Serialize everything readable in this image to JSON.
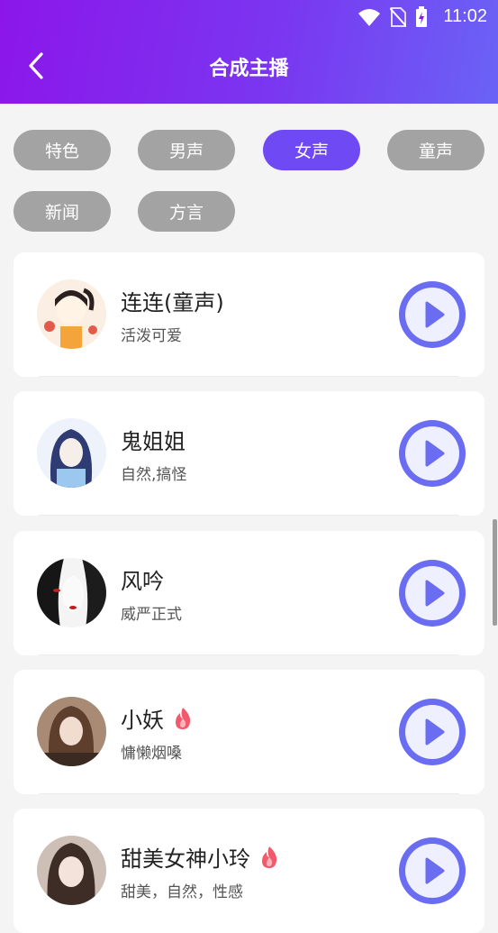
{
  "status_bar": {
    "time": "11:02"
  },
  "header": {
    "title": "合成主播"
  },
  "categories": [
    {
      "label": "特色",
      "active": false
    },
    {
      "label": "男声",
      "active": false
    },
    {
      "label": "女声",
      "active": true
    },
    {
      "label": "童声",
      "active": false
    },
    {
      "label": "新闻",
      "active": false
    },
    {
      "label": "方言",
      "active": false
    }
  ],
  "voices": [
    {
      "name": "连连(童声)",
      "desc": "活泼可爱",
      "hot": false
    },
    {
      "name": "鬼姐姐",
      "desc": "自然,搞怪",
      "hot": false
    },
    {
      "name": "风吟",
      "desc": "威严正式",
      "hot": false
    },
    {
      "name": "小妖",
      "desc": "慵懒烟嗓",
      "hot": true
    },
    {
      "name": "甜美女神小玲",
      "desc": "甜美，自然，性感",
      "hot": true
    }
  ],
  "colors": {
    "header_start": "#8c16ea",
    "header_end": "#6a63f6",
    "chip_active": "#6f49f3",
    "chip_inactive": "#a3a3a3",
    "play_accent": "#6a6cf2"
  }
}
